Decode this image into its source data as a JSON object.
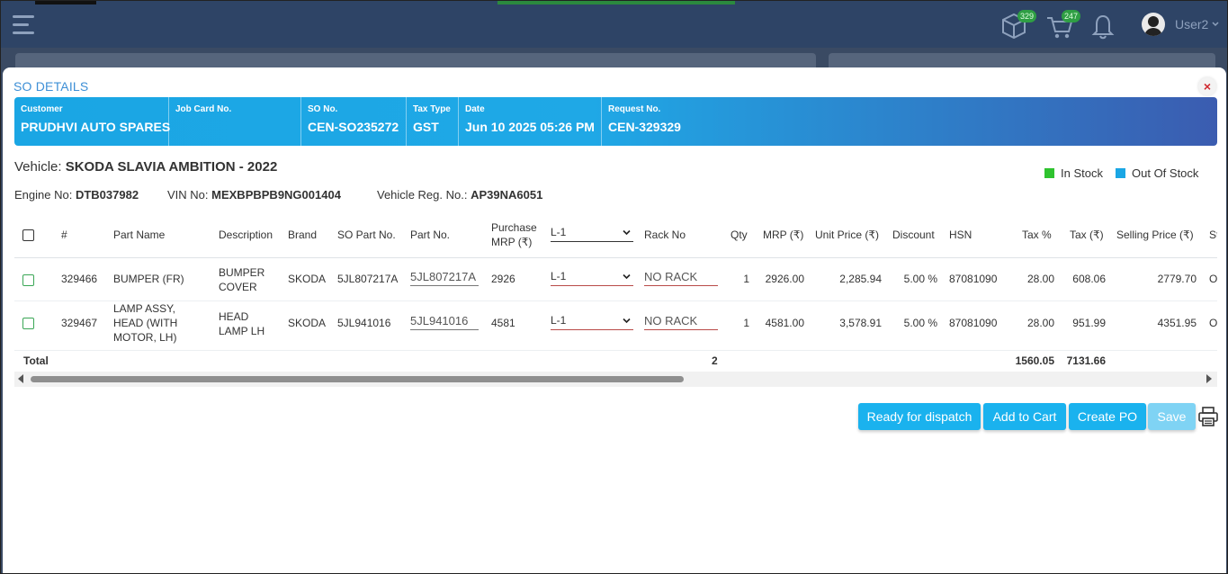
{
  "topbar": {
    "bag_badge": "329",
    "cart_badge": "247",
    "username": "User2"
  },
  "modal": {
    "title": "SO DETAILS",
    "close_symbol": "×"
  },
  "banner": {
    "customer_label": "Customer",
    "customer_value": "PRUDHVI AUTO SPARES",
    "jobcard_label": "Job Card No.",
    "jobcard_value": "",
    "so_label": "SO No.",
    "so_value": "CEN-SO235272",
    "taxtype_label": "Tax Type",
    "taxtype_value": "GST",
    "date_label": "Date",
    "date_value": "Jun 10 2025 05:26 PM",
    "request_label": "Request No.",
    "request_value": "CEN-329329"
  },
  "vehicle": {
    "label": "Vehicle:",
    "value": "SKODA SLAVIA AMBITION - 2022",
    "engine_label": "Engine No:",
    "engine_value": "DTB037982",
    "vin_label": "VIN No:",
    "vin_value": "MEXBPBPB9NG001404",
    "reg_label": "Vehicle Reg. No.:",
    "reg_value": "AP39NA6051"
  },
  "legend": {
    "in_stock": "In Stock",
    "out_of_stock": "Out Of Stock",
    "in_stock_color": "#2fc32f",
    "out_of_stock_color": "#1aa6e4"
  },
  "table": {
    "headers": {
      "num": "#",
      "part_name": "Part Name",
      "description": "Description",
      "brand": "Brand",
      "so_part_no": "SO Part No.",
      "part_no": "Part No.",
      "purchase_mrp_1": "Purchase",
      "purchase_mrp_2": "MRP (₹)",
      "level_select": "L-1",
      "rack_no": "Rack No",
      "qty": "Qty",
      "mrp": "MRP (₹)",
      "unit_price": "Unit Price (₹)",
      "discount": "Discount",
      "hsn": "HSN",
      "tax_pct": "Tax %",
      "tax": "Tax (₹)",
      "selling_price": "Selling Price (₹)",
      "status": "St"
    },
    "rows": [
      {
        "num": "329466",
        "part_name_1": "BUMPER (FR)",
        "part_name_2": "",
        "part_name_3": "",
        "desc_1": "BUMPER",
        "desc_2": "COVER",
        "brand": "SKODA",
        "so_part_no": "5JL807217A",
        "part_no": "5JL807217A",
        "purchase_mrp": "2926",
        "level": "L-1",
        "rack": "NO RACK",
        "qty": "1",
        "mrp": "2926.00",
        "unit_price": "2,285.94",
        "discount": "5.00 %",
        "hsn": "87081090",
        "tax_pct": "28.00",
        "tax": "608.06",
        "selling_price": "2779.70",
        "status": "Ol"
      },
      {
        "num": "329467",
        "part_name_1": "LAMP ASSY,",
        "part_name_2": "HEAD (WITH",
        "part_name_3": "MOTOR, LH)",
        "desc_1": "HEAD",
        "desc_2": "LAMP LH",
        "brand": "SKODA",
        "so_part_no": "5JL941016",
        "part_no": "5JL941016",
        "purchase_mrp": "4581",
        "level": "L-1",
        "rack": "NO RACK",
        "qty": "1",
        "mrp": "4581.00",
        "unit_price": "3,578.91",
        "discount": "5.00 %",
        "hsn": "87081090",
        "tax_pct": "28.00",
        "tax": "951.99",
        "selling_price": "4351.95",
        "status": "Ol"
      }
    ],
    "totals": {
      "label": "Total",
      "qty": "2",
      "tax_pct": "1560.05",
      "tax": "7131.66"
    }
  },
  "actions": {
    "ready": "Ready for dispatch",
    "add_cart": "Add to Cart",
    "create_po": "Create PO",
    "save": "Save"
  }
}
